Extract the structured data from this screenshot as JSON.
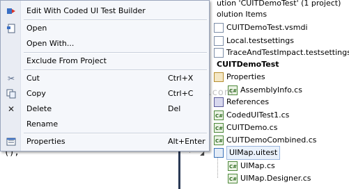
{
  "editor": {
    "code_fragment": "();"
  },
  "watermark": "© DotNetCurry.com",
  "solution_explorer": {
    "rows": [
      {
        "label": "ution 'CUITDemoTest' (1 project)"
      },
      {
        "label": "olution Items"
      },
      {
        "label": "CUITDemoTest.vsmdi"
      },
      {
        "label": "Local.testsettings"
      },
      {
        "label": "TraceAndTestImpact.testsettings"
      },
      {
        "label": "CUITDemoTest"
      },
      {
        "label": "Properties"
      },
      {
        "label": "AssemblyInfo.cs"
      },
      {
        "label": "References"
      },
      {
        "label": "CodedUITest1.cs"
      },
      {
        "label": "CUITDemo.cs"
      },
      {
        "label": "CUITDemoCombined.cs"
      },
      {
        "label": "UIMap.uitest"
      },
      {
        "label": "UIMap.cs"
      },
      {
        "label": "UIMap.Designer.cs"
      }
    ]
  },
  "context_menu": {
    "items": [
      {
        "label": "Edit With Coded UI Test Builder",
        "shortcut": "",
        "icon": "coded-ui-builder-icon"
      },
      {
        "label": "Open",
        "shortcut": "",
        "icon": "open-file-icon"
      },
      {
        "label": "Open With...",
        "shortcut": "",
        "icon": ""
      },
      {
        "label": "Exclude From Project",
        "shortcut": "",
        "icon": ""
      },
      {
        "label": "Cut",
        "shortcut": "Ctrl+X",
        "icon": "scissors-icon"
      },
      {
        "label": "Copy",
        "shortcut": "Ctrl+C",
        "icon": "copy-icon"
      },
      {
        "label": "Delete",
        "shortcut": "Del",
        "icon": "delete-x-icon"
      },
      {
        "label": "Rename",
        "shortcut": "",
        "icon": ""
      },
      {
        "label": "Properties",
        "shortcut": "Alt+Enter",
        "icon": "properties-icon"
      }
    ]
  }
}
